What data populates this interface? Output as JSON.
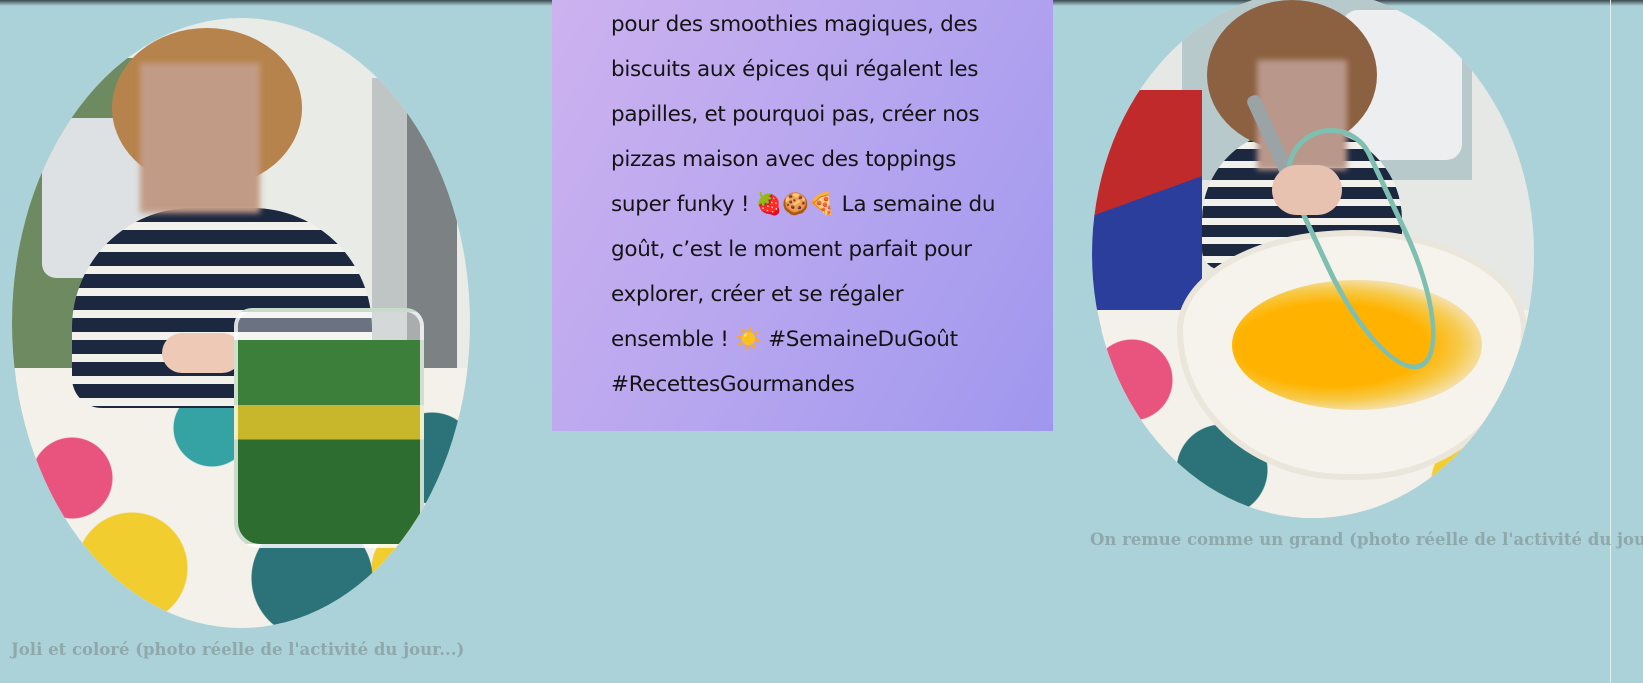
{
  "article": {
    "body_text": "pour des smoothies magiques, des biscuits aux épices qui régalent les papilles, et pourquoi pas, créer nos pizzas maison avec des toppings super funky ! 🍓🍪🍕 La semaine du goût, c’est le moment parfait pour explorer, créer et se régaler ensemble ! ☀️ #SemaineDuGoût #RecettesGourmandes"
  },
  "gallery": {
    "left_photo": {
      "caption": "Joli et coloré (photo réelle de l'activité du jour...)"
    },
    "right_photo": {
      "caption": "On remue comme un grand (photo réelle de l'activité du jour ...)"
    }
  },
  "colors": {
    "page_background": "#abd2d8",
    "text_box_gradient_start": "#cdb2ef",
    "text_box_gradient_end": "#9f97ee",
    "caption": "#8ea8ab"
  }
}
